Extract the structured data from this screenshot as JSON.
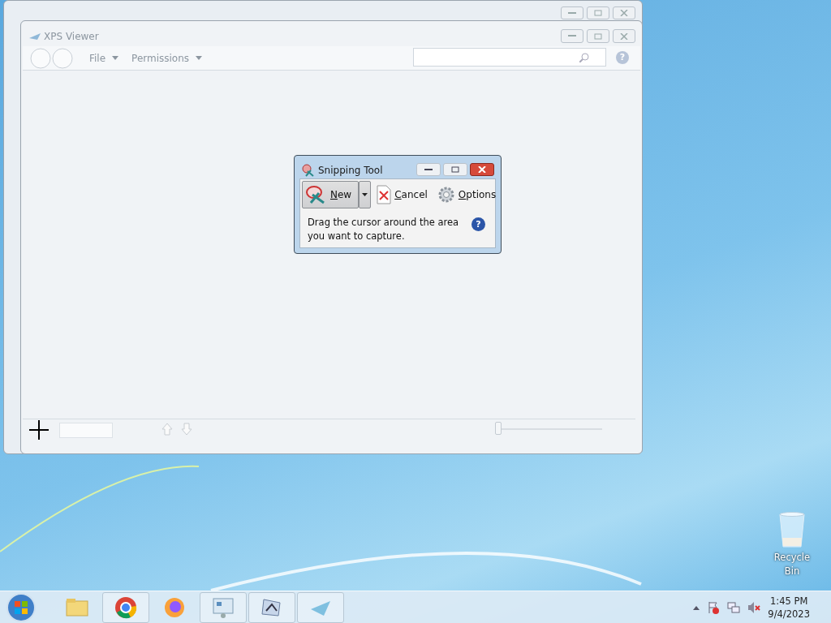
{
  "xps_viewer": {
    "title": "XPS Viewer",
    "help": "?",
    "menu": [
      {
        "label": "File"
      },
      {
        "label": "Permissions"
      }
    ],
    "zoom_slider": {
      "level": 0
    }
  },
  "snipping_tool": {
    "title": "Snipping Tool",
    "buttons": [
      {
        "label": "New",
        "kind": "split",
        "pressed": true
      },
      {
        "label": "Cancel",
        "kind": "cancel",
        "pressed": false
      },
      {
        "label": "Options",
        "kind": "options",
        "pressed": false
      }
    ],
    "message": "Drag the cursor around the area you want to capture.",
    "help": "?"
  },
  "desktop": {
    "icons": [
      {
        "label": "Recycle Bin"
      }
    ]
  },
  "taskbar": {
    "items": [
      {
        "kind": "explorer",
        "running": false
      },
      {
        "kind": "chrome",
        "running": true
      },
      {
        "kind": "firefox",
        "running": false
      },
      {
        "kind": "control",
        "running": true
      },
      {
        "kind": "snip",
        "running": true
      },
      {
        "kind": "xps",
        "running": true
      }
    ],
    "clock": {
      "time": "1:45 PM",
      "date": "9/4/2023"
    }
  }
}
